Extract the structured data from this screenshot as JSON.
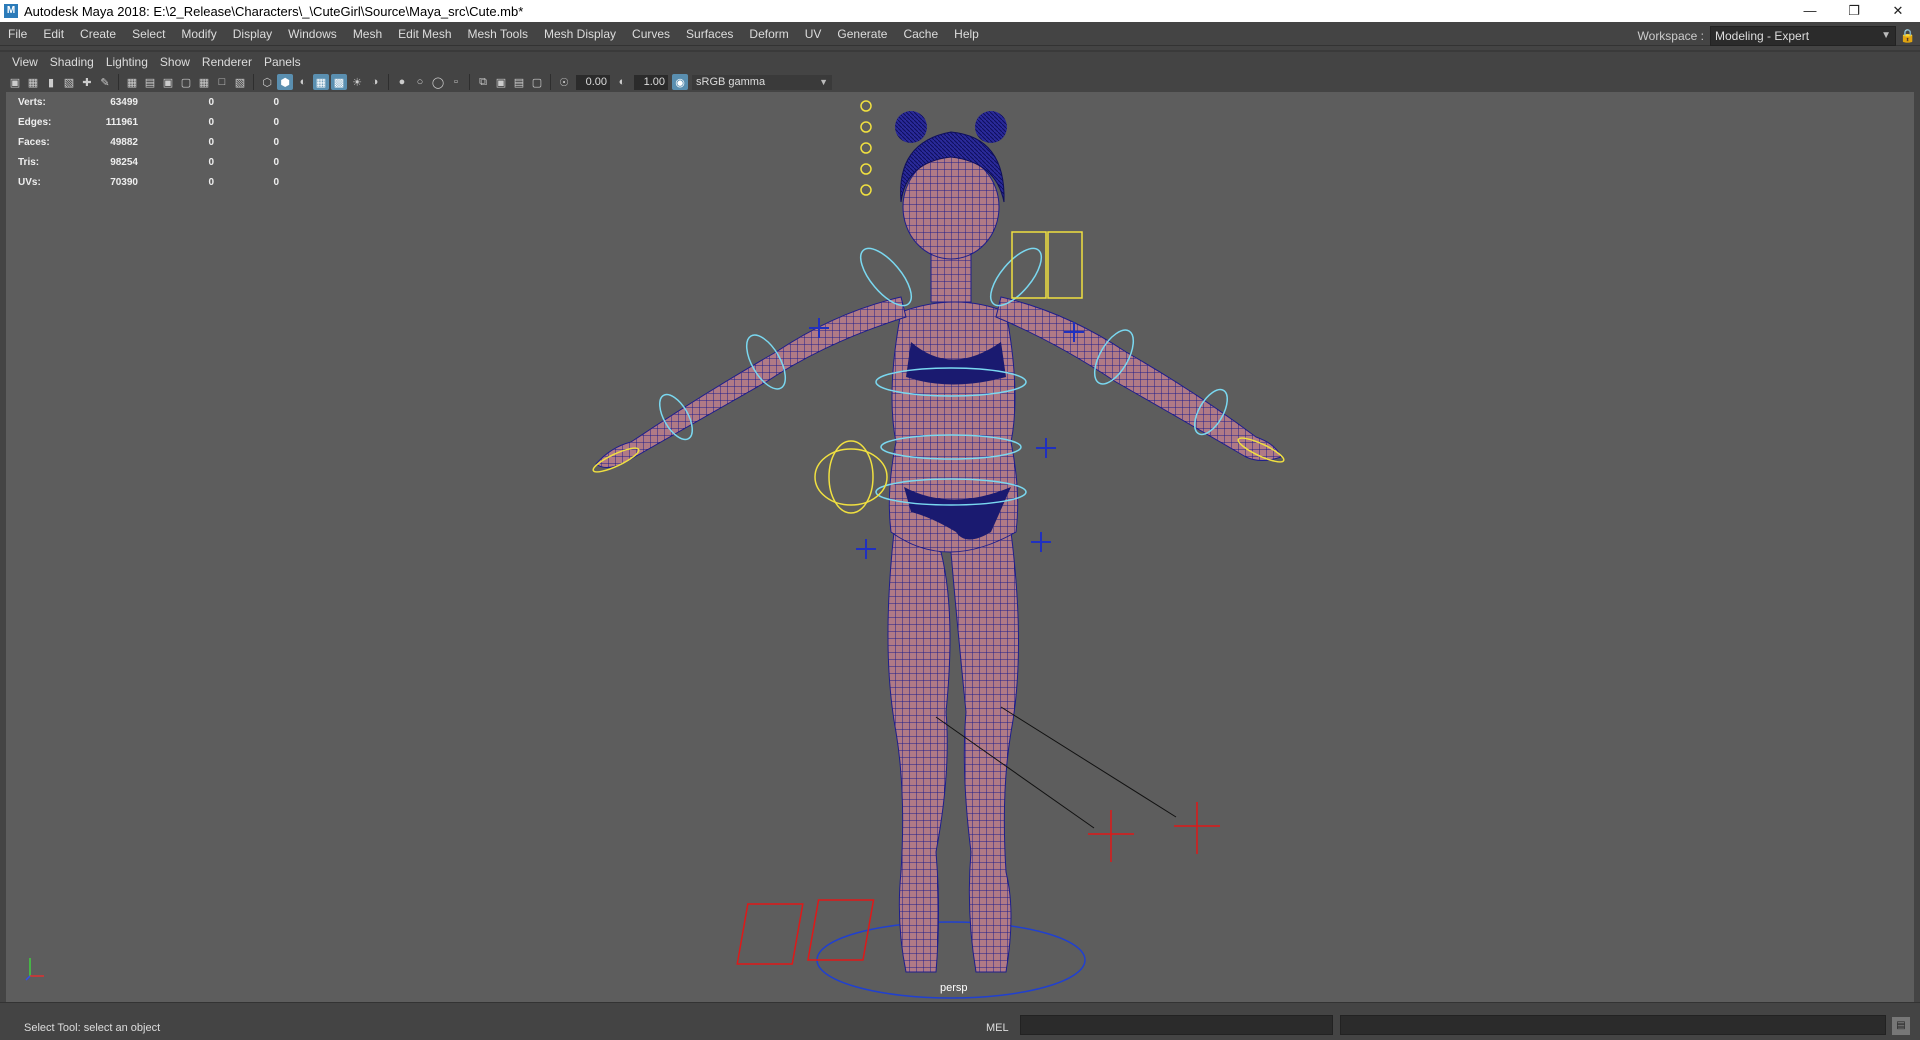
{
  "window": {
    "title": "Autodesk Maya 2018: E:\\2_Release\\Characters\\_\\CuteGirl\\Source\\Maya_src\\Cute.mb*",
    "app_icon": "M",
    "controls": [
      "minimize-icon",
      "restore-icon",
      "close-icon"
    ]
  },
  "menubar": {
    "items": [
      "File",
      "Edit",
      "Create",
      "Select",
      "Modify",
      "Display",
      "Windows",
      "Mesh",
      "Edit Mesh",
      "Mesh Tools",
      "Mesh Display",
      "Curves",
      "Surfaces",
      "Deform",
      "UV",
      "Generate",
      "Cache",
      "Help"
    ]
  },
  "workspace": {
    "label": "Workspace :",
    "value": "Modeling - Expert"
  },
  "panel_menu": {
    "items": [
      "View",
      "Shading",
      "Lighting",
      "Show",
      "Renderer",
      "Panels"
    ]
  },
  "panel_toolbar": {
    "exposure": "0.00",
    "gamma": "1.00",
    "color_space": "sRGB gamma"
  },
  "hud": {
    "rows": [
      {
        "label": "Verts:",
        "v1": "63499",
        "v2": "0",
        "v3": "0"
      },
      {
        "label": "Edges:",
        "v1": "111961",
        "v2": "0",
        "v3": "0"
      },
      {
        "label": "Faces:",
        "v1": "49882",
        "v2": "0",
        "v3": "0"
      },
      {
        "label": "Tris:",
        "v1": "98254",
        "v2": "0",
        "v3": "0"
      },
      {
        "label": "UVs:",
        "v1": "70390",
        "v2": "0",
        "v3": "0"
      }
    ]
  },
  "viewport": {
    "camera": "persp",
    "background_color": "#5d5d5d",
    "mesh_color": "#1e1e8c",
    "skin_color": "#b07a86",
    "control_cyan": "#7ad8f0",
    "control_yellow": "#f0e040",
    "locator_red": "#e01818",
    "control_blue": "#2030c0"
  },
  "status": {
    "help_text": "Select Tool: select an object",
    "mel_label": "MEL"
  },
  "colors": {
    "ui_bg": "#444444",
    "field_bg": "#2b2b2b",
    "accent": "#5a8fb0"
  }
}
